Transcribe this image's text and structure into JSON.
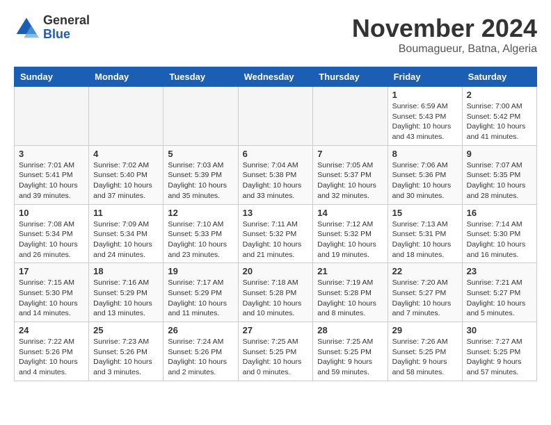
{
  "header": {
    "logo_general": "General",
    "logo_blue": "Blue",
    "month_title": "November 2024",
    "location": "Boumagueur, Batna, Algeria"
  },
  "days_of_week": [
    "Sunday",
    "Monday",
    "Tuesday",
    "Wednesday",
    "Thursday",
    "Friday",
    "Saturday"
  ],
  "weeks": [
    [
      {
        "day": "",
        "info": ""
      },
      {
        "day": "",
        "info": ""
      },
      {
        "day": "",
        "info": ""
      },
      {
        "day": "",
        "info": ""
      },
      {
        "day": "",
        "info": ""
      },
      {
        "day": "1",
        "info": "Sunrise: 6:59 AM\nSunset: 5:43 PM\nDaylight: 10 hours and 43 minutes."
      },
      {
        "day": "2",
        "info": "Sunrise: 7:00 AM\nSunset: 5:42 PM\nDaylight: 10 hours and 41 minutes."
      }
    ],
    [
      {
        "day": "3",
        "info": "Sunrise: 7:01 AM\nSunset: 5:41 PM\nDaylight: 10 hours and 39 minutes."
      },
      {
        "day": "4",
        "info": "Sunrise: 7:02 AM\nSunset: 5:40 PM\nDaylight: 10 hours and 37 minutes."
      },
      {
        "day": "5",
        "info": "Sunrise: 7:03 AM\nSunset: 5:39 PM\nDaylight: 10 hours and 35 minutes."
      },
      {
        "day": "6",
        "info": "Sunrise: 7:04 AM\nSunset: 5:38 PM\nDaylight: 10 hours and 33 minutes."
      },
      {
        "day": "7",
        "info": "Sunrise: 7:05 AM\nSunset: 5:37 PM\nDaylight: 10 hours and 32 minutes."
      },
      {
        "day": "8",
        "info": "Sunrise: 7:06 AM\nSunset: 5:36 PM\nDaylight: 10 hours and 30 minutes."
      },
      {
        "day": "9",
        "info": "Sunrise: 7:07 AM\nSunset: 5:35 PM\nDaylight: 10 hours and 28 minutes."
      }
    ],
    [
      {
        "day": "10",
        "info": "Sunrise: 7:08 AM\nSunset: 5:34 PM\nDaylight: 10 hours and 26 minutes."
      },
      {
        "day": "11",
        "info": "Sunrise: 7:09 AM\nSunset: 5:34 PM\nDaylight: 10 hours and 24 minutes."
      },
      {
        "day": "12",
        "info": "Sunrise: 7:10 AM\nSunset: 5:33 PM\nDaylight: 10 hours and 23 minutes."
      },
      {
        "day": "13",
        "info": "Sunrise: 7:11 AM\nSunset: 5:32 PM\nDaylight: 10 hours and 21 minutes."
      },
      {
        "day": "14",
        "info": "Sunrise: 7:12 AM\nSunset: 5:32 PM\nDaylight: 10 hours and 19 minutes."
      },
      {
        "day": "15",
        "info": "Sunrise: 7:13 AM\nSunset: 5:31 PM\nDaylight: 10 hours and 18 minutes."
      },
      {
        "day": "16",
        "info": "Sunrise: 7:14 AM\nSunset: 5:30 PM\nDaylight: 10 hours and 16 minutes."
      }
    ],
    [
      {
        "day": "17",
        "info": "Sunrise: 7:15 AM\nSunset: 5:30 PM\nDaylight: 10 hours and 14 minutes."
      },
      {
        "day": "18",
        "info": "Sunrise: 7:16 AM\nSunset: 5:29 PM\nDaylight: 10 hours and 13 minutes."
      },
      {
        "day": "19",
        "info": "Sunrise: 7:17 AM\nSunset: 5:29 PM\nDaylight: 10 hours and 11 minutes."
      },
      {
        "day": "20",
        "info": "Sunrise: 7:18 AM\nSunset: 5:28 PM\nDaylight: 10 hours and 10 minutes."
      },
      {
        "day": "21",
        "info": "Sunrise: 7:19 AM\nSunset: 5:28 PM\nDaylight: 10 hours and 8 minutes."
      },
      {
        "day": "22",
        "info": "Sunrise: 7:20 AM\nSunset: 5:27 PM\nDaylight: 10 hours and 7 minutes."
      },
      {
        "day": "23",
        "info": "Sunrise: 7:21 AM\nSunset: 5:27 PM\nDaylight: 10 hours and 5 minutes."
      }
    ],
    [
      {
        "day": "24",
        "info": "Sunrise: 7:22 AM\nSunset: 5:26 PM\nDaylight: 10 hours and 4 minutes."
      },
      {
        "day": "25",
        "info": "Sunrise: 7:23 AM\nSunset: 5:26 PM\nDaylight: 10 hours and 3 minutes."
      },
      {
        "day": "26",
        "info": "Sunrise: 7:24 AM\nSunset: 5:26 PM\nDaylight: 10 hours and 2 minutes."
      },
      {
        "day": "27",
        "info": "Sunrise: 7:25 AM\nSunset: 5:25 PM\nDaylight: 10 hours and 0 minutes."
      },
      {
        "day": "28",
        "info": "Sunrise: 7:25 AM\nSunset: 5:25 PM\nDaylight: 9 hours and 59 minutes."
      },
      {
        "day": "29",
        "info": "Sunrise: 7:26 AM\nSunset: 5:25 PM\nDaylight: 9 hours and 58 minutes."
      },
      {
        "day": "30",
        "info": "Sunrise: 7:27 AM\nSunset: 5:25 PM\nDaylight: 9 hours and 57 minutes."
      }
    ]
  ]
}
